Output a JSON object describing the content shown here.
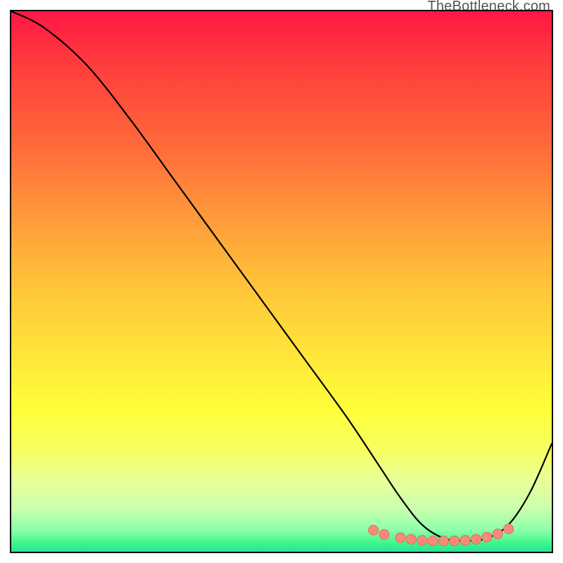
{
  "watermark": "TheBottleneck.com",
  "chart_data": {
    "type": "line",
    "title": "",
    "xlabel": "",
    "ylabel": "",
    "xlim": [
      0,
      100
    ],
    "ylim": [
      0,
      100
    ],
    "series": [
      {
        "name": "bottleneck-curve",
        "x": [
          0,
          6,
          14,
          22,
          30,
          38,
          46,
          54,
          62,
          68,
          72,
          76,
          80,
          84,
          88,
          92,
          96,
          100
        ],
        "y": [
          100,
          97,
          90,
          80,
          69,
          58,
          47,
          36,
          25,
          16,
          10,
          5,
          2.5,
          2,
          2.5,
          5,
          11,
          20
        ]
      }
    ],
    "markers": {
      "name": "highlight-points",
      "x": [
        67,
        69,
        72,
        74,
        76,
        78,
        80,
        82,
        84,
        86,
        88,
        90,
        92
      ],
      "y": [
        4.0,
        3.2,
        2.6,
        2.3,
        2.1,
        2.0,
        2.0,
        2.0,
        2.1,
        2.3,
        2.7,
        3.3,
        4.2
      ]
    },
    "colors": {
      "curve": "#000000",
      "marker_fill": "#f98a7a",
      "marker_stroke": "#e46a5a"
    }
  }
}
